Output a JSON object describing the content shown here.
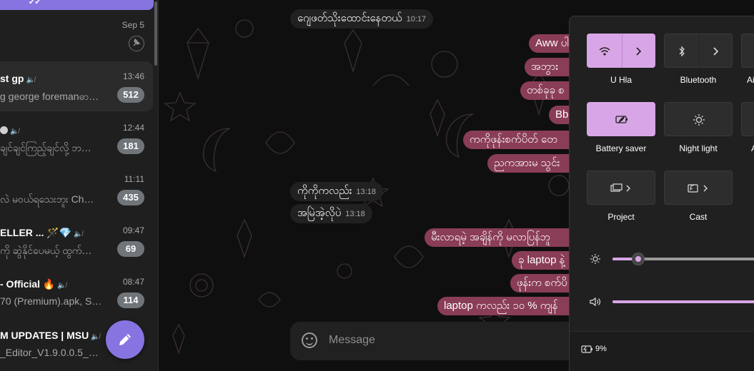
{
  "chats": [
    {
      "title": "",
      "time": "Sep 5",
      "preview": "",
      "badge": ""
    },
    {
      "title": "st gp",
      "time": "13:46",
      "preview": "g george foremanဓာ…",
      "badge": "512"
    },
    {
      "title": "",
      "time": "12:44",
      "preview": "ချင်ချင်ကြည့်ချင်လို့ ဘ…",
      "badge": "181"
    },
    {
      "title": "",
      "time": "11:11",
      "preview": "လဲ မဝယ်ရသေးဘူး Ch…",
      "badge": "435"
    },
    {
      "title": "ELLER ... 🪄💎",
      "time": "09:47",
      "preview": "ကို ဆွဲနိုင်ပေမယ့် ထွက်…",
      "badge": "69"
    },
    {
      "title": "- Official 🔥",
      "time": "08:47",
      "preview": "70 (Premium).apk, S…",
      "badge": "114"
    },
    {
      "title": "M UPDATES | MSU",
      "time": "",
      "preview": "_Editor_V1.9.0.0.5_…",
      "badge": ""
    }
  ],
  "messages": [
    {
      "dir": "in",
      "text": "ဂျေဖတ်သိုးထောင်းနေတယ်",
      "time": "10:17"
    },
    {
      "dir": "out",
      "text": "Aww ပါ"
    },
    {
      "dir": "out",
      "text": "အဘွား"
    },
    {
      "dir": "out",
      "text": "တစ်ခုခု စ"
    },
    {
      "dir": "out",
      "text": "Bb"
    },
    {
      "dir": "out",
      "text": "ကကိုဖုန်းစက်ပိတ် တေ"
    },
    {
      "dir": "out",
      "text": "ညကအားမ သွင်း"
    },
    {
      "dir": "in",
      "text": "ကိုကိုကလည်း",
      "time": "13:18"
    },
    {
      "dir": "in",
      "text": "အမြဲအဲ့လိုပဲ",
      "time": "13:18"
    },
    {
      "dir": "out",
      "text": "မီးလာရမဲ့ အချိန်ကို မလာပြန်ဘူ"
    },
    {
      "dir": "out",
      "text": "ခု laptop နဲ့"
    },
    {
      "dir": "out",
      "text": "ဖုန်းက စက်ပိ"
    },
    {
      "dir": "out",
      "text": "laptop ကလည်း ၁၀ % ကျန်"
    }
  ],
  "composer": {
    "placeholder": "Message"
  },
  "quick_settings": {
    "tiles": [
      {
        "label": "U Hla",
        "icon": "wifi-icon",
        "on": true
      },
      {
        "label": "Bluetooth",
        "icon": "bluetooth-icon",
        "on": false
      },
      {
        "label": "Ai",
        "icon": "airplane-icon",
        "on": false
      },
      {
        "label": "Battery saver",
        "icon": "battery-saver-icon",
        "on": true
      },
      {
        "label": "Night light",
        "icon": "night-light-icon",
        "on": false
      },
      {
        "label": "A",
        "icon": "accessibility-icon",
        "on": false
      },
      {
        "label": "Project",
        "icon": "project-icon",
        "on": false
      },
      {
        "label": "Cast",
        "icon": "cast-icon",
        "on": false
      }
    ],
    "brightness_level": 0.17,
    "volume_level": 1.0,
    "battery_percent": "9%"
  },
  "colors": {
    "accent": "#8774e1",
    "outgoing": "#8a3d56",
    "tile_on": "#d8a6e6"
  }
}
